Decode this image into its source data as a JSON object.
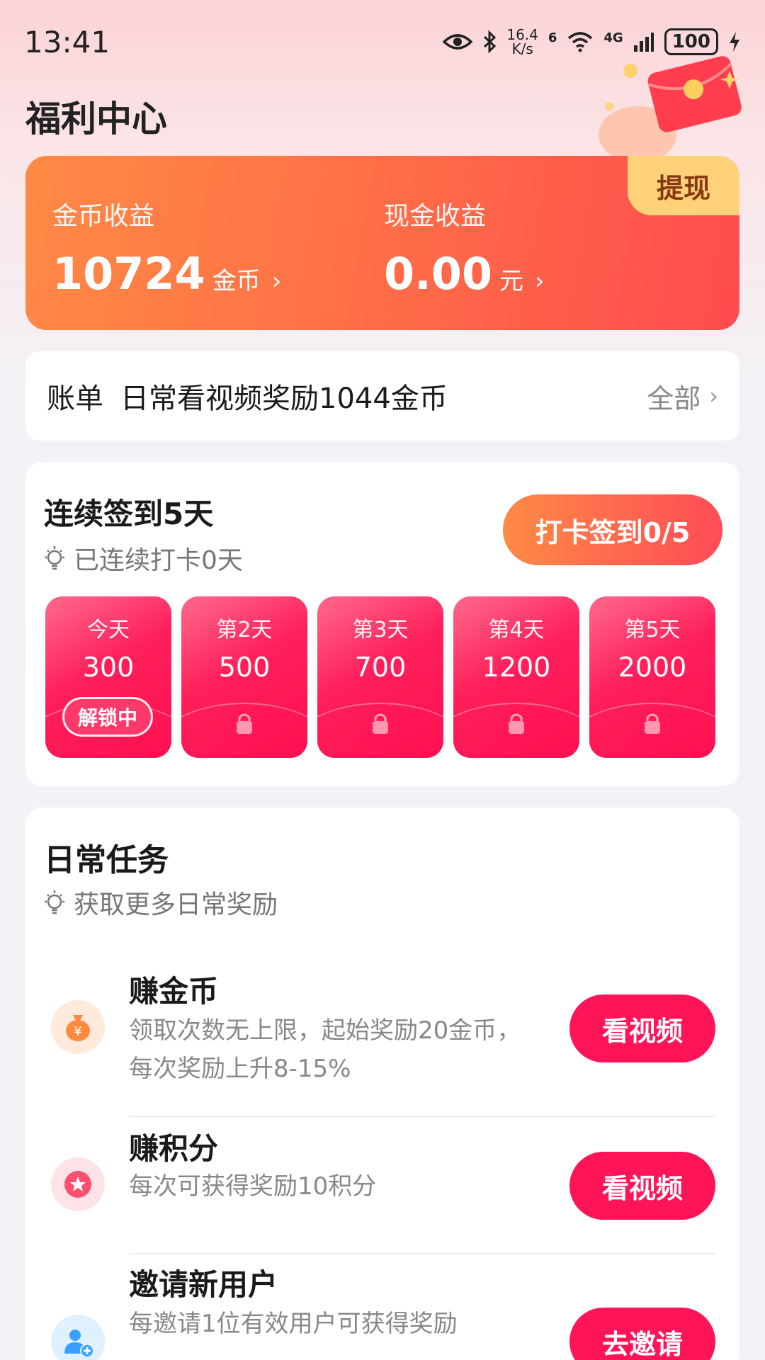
{
  "status_bar": {
    "time": "13:41",
    "net_speed_top": "16.4",
    "net_speed_unit": "K/s",
    "wifi_label": "6",
    "cell_label": "4G",
    "battery": "100",
    "icons": [
      "eye-icon",
      "bluetooth-icon",
      "wifi-icon",
      "signal-icon",
      "battery-icon",
      "charging-icon"
    ]
  },
  "page": {
    "title": "福利中心"
  },
  "earnings": {
    "withdraw_label": "提现",
    "coin": {
      "label": "金币收益",
      "value": "10724",
      "unit": "金币",
      "chevron": "›"
    },
    "cash": {
      "label": "现金收益",
      "value": "0.00",
      "unit": "元",
      "chevron": "›"
    }
  },
  "bill": {
    "title": "账单",
    "latest": "日常看视频奖励1044金币",
    "all_label": "全部",
    "chevron": "›"
  },
  "signin": {
    "title": "连续签到5天",
    "subtitle": "已连续打卡0天",
    "button_label": "打卡签到0/5",
    "days": [
      {
        "label": "今天",
        "value": "300",
        "status": "解锁中"
      },
      {
        "label": "第2天",
        "value": "500"
      },
      {
        "label": "第3天",
        "value": "700"
      },
      {
        "label": "第4天",
        "value": "1200"
      },
      {
        "label": "第5天",
        "value": "2000"
      }
    ]
  },
  "tasks": {
    "title": "日常任务",
    "subtitle": "获取更多日常奖励",
    "items": [
      {
        "name": "赚金币",
        "desc": "领取次数无上限，起始奖励20金币，每次奖励上升8-15%",
        "button": "看视频",
        "icon": "money-bag-icon",
        "icon_color": "#ff8a3d"
      },
      {
        "name": "赚积分",
        "desc": "每次可获得奖励10积分",
        "button": "看视频",
        "icon": "star-badge-icon",
        "icon_color": "#ff4f6e"
      },
      {
        "name": "邀请新用户",
        "desc": "每邀请1位有效用户可获得奖励",
        "button": "去邀请",
        "icon": "add-user-icon",
        "icon_color": "#3aa0ff"
      }
    ]
  },
  "colors": {
    "accent": "#ff1458",
    "orange_gradient_start": "#ff8a45",
    "orange_gradient_end": "#ff4b4f",
    "withdraw_bg": "#ffd27a"
  }
}
